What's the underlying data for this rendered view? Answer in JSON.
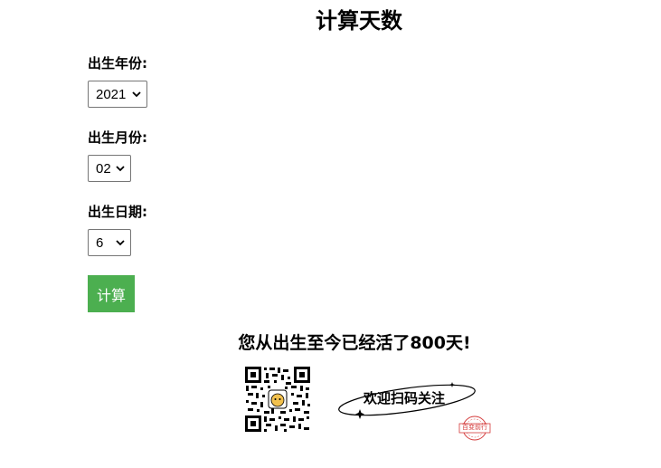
{
  "page": {
    "title": "计算天数"
  },
  "form": {
    "year": {
      "label": "出生年份:",
      "selected": "2021"
    },
    "month": {
      "label": "出生月份:",
      "selected": "02"
    },
    "day": {
      "label": "出生日期:",
      "selected": "6"
    },
    "submit_label": "计算"
  },
  "result": {
    "text": "您从出生至今已经活了800天!"
  },
  "promo": {
    "slogan": "欢迎扫码关注",
    "stamp": "百变前行"
  },
  "colors": {
    "button_bg": "#4caf50",
    "button_text": "#ffffff",
    "stamp": "#d43a3a"
  },
  "icons": {
    "select_arrow": "chevron-down-icon",
    "qr": "qr-code-icon",
    "sparkle": "sparkle-icon"
  }
}
